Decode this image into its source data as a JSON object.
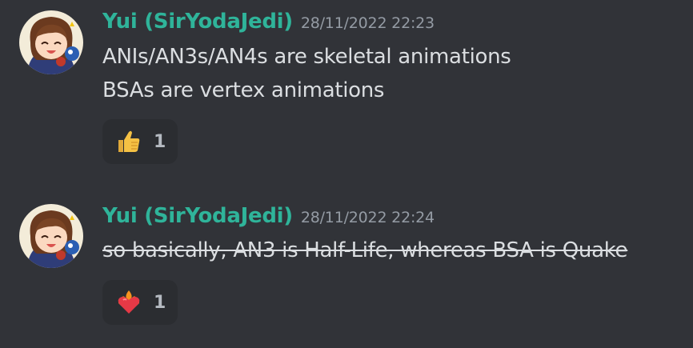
{
  "messages": [
    {
      "username": "Yui (SirYodaJedi)",
      "timestamp": "28/11/2022 22:23",
      "lines": [
        "ANIs/AN3s/AN4s are skeletal animations",
        "BSAs are vertex animations"
      ],
      "strikethrough": false,
      "reaction": {
        "emoji": "thumbs-up-icon",
        "count": "1"
      }
    },
    {
      "username": "Yui (SirYodaJedi)",
      "timestamp": "28/11/2022 22:24",
      "lines": [
        "so basically, AN3 is Half-Life, whereas BSA is Quake"
      ],
      "strikethrough": true,
      "reaction": {
        "emoji": "heart-on-fire-icon",
        "count": "1"
      }
    }
  ],
  "colors": {
    "background": "#313338",
    "username": "#2fb49a",
    "timestamp": "#949ba4",
    "text": "#dbdee1",
    "reaction_bg": "#2b2d31"
  }
}
